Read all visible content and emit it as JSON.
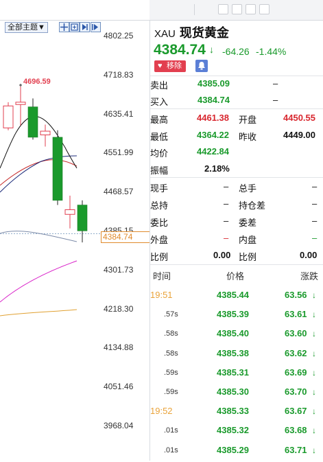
{
  "toolbar": {
    "theme_select": "全部主题▼"
  },
  "chart": {
    "price_axis": [
      "4802.25",
      "4718.83",
      "4635.41",
      "4551.99",
      "4468.57",
      "4385.15",
      "4301.73",
      "4218.30",
      "4134.88",
      "4051.46",
      "3968.04"
    ],
    "high_marker": "4696.59",
    "current_price_box": "4384.74",
    "colors": {
      "up": "#e23f4f",
      "down": "#1a9a2c",
      "ma_black": "#111111",
      "ma_navy": "#1c2b7a",
      "ma_red": "#c62828",
      "ma_magenta": "#d81fc8",
      "ma_orange": "#e0a030"
    }
  },
  "chart_data": {
    "type": "candlestick",
    "ylim": [
      3968.04,
      4802.25
    ],
    "candles": [
      {
        "open": 4652,
        "high": 4660,
        "low": 4600,
        "close": 4605,
        "color": "up"
      },
      {
        "open": 4655,
        "high": 4696.59,
        "low": 4610,
        "close": 4660,
        "color": "up"
      },
      {
        "open": 4650,
        "high": 4668,
        "low": 4580,
        "close": 4585,
        "color": "down"
      },
      {
        "open": 4598,
        "high": 4612,
        "low": 4565,
        "close": 4590,
        "color": "up"
      },
      {
        "open": 4585,
        "high": 4600,
        "low": 4440,
        "close": 4450,
        "color": "down"
      },
      {
        "open": 4420,
        "high": 4460,
        "low": 4390,
        "close": 4430,
        "color": "up"
      },
      {
        "open": 4440,
        "high": 4450,
        "low": 4360,
        "close": 4384.74,
        "color": "down"
      }
    ]
  },
  "quote": {
    "code": "XAU",
    "name": "现货黄金",
    "price": "4384.74",
    "arrow": "↓",
    "change": "-64.26",
    "percent": "-1.44%",
    "remove_label": "移除",
    "remove_icon": "heart-icon",
    "bell_icon": "bell-icon"
  },
  "orderbook": {
    "sell_label": "卖出",
    "sell_value": "4385.09",
    "sell_dash": "–",
    "buy_label": "买入",
    "buy_value": "4384.74",
    "buy_dash": "–"
  },
  "stats": {
    "high_label": "最高",
    "high_value": "4461.38",
    "open_label": "开盘",
    "open_value": "4450.55",
    "low_label": "最低",
    "low_value": "4364.22",
    "prevclose_label": "昨收",
    "prevclose_value": "4449.00",
    "avg_label": "均价",
    "avg_value": "4422.84",
    "amp_label": "振幅",
    "amp_value": "2.18%",
    "vol_label": "现手",
    "vol_value": "–",
    "total_vol_label": "总手",
    "total_vol_value": "–",
    "oi_label": "总持",
    "oi_value": "–",
    "oi_diff_label": "持仓差",
    "oi_diff_value": "–",
    "bid_ratio_label": "委比",
    "bid_ratio_value": "–",
    "bid_diff_label": "委差",
    "bid_diff_value": "–",
    "outer_label": "外盘",
    "outer_value": "–",
    "inner_label": "内盘",
    "inner_value": "–",
    "ratio1_label": "比例",
    "ratio1_value": "0.00",
    "ratio2_label": "比例",
    "ratio2_value": "0.00"
  },
  "ticks": {
    "col_time": "时间",
    "col_price": "价格",
    "col_change": "涨跌",
    "rows": [
      {
        "time": "19:51",
        "major": true,
        "price": "4385.44",
        "change": "63.56"
      },
      {
        "time": ".57s",
        "major": false,
        "price": "4385.39",
        "change": "63.61"
      },
      {
        "time": ".58s",
        "major": false,
        "price": "4385.40",
        "change": "63.60"
      },
      {
        "time": ".58s",
        "major": false,
        "price": "4385.38",
        "change": "63.62"
      },
      {
        "time": ".59s",
        "major": false,
        "price": "4385.31",
        "change": "63.69"
      },
      {
        "time": ".59s",
        "major": false,
        "price": "4385.30",
        "change": "63.70"
      },
      {
        "time": "19:52",
        "major": true,
        "price": "4385.33",
        "change": "63.67"
      },
      {
        "time": ".01s",
        "major": false,
        "price": "4385.32",
        "change": "63.68"
      },
      {
        "time": ".01s",
        "major": false,
        "price": "4385.29",
        "change": "63.71"
      }
    ]
  }
}
